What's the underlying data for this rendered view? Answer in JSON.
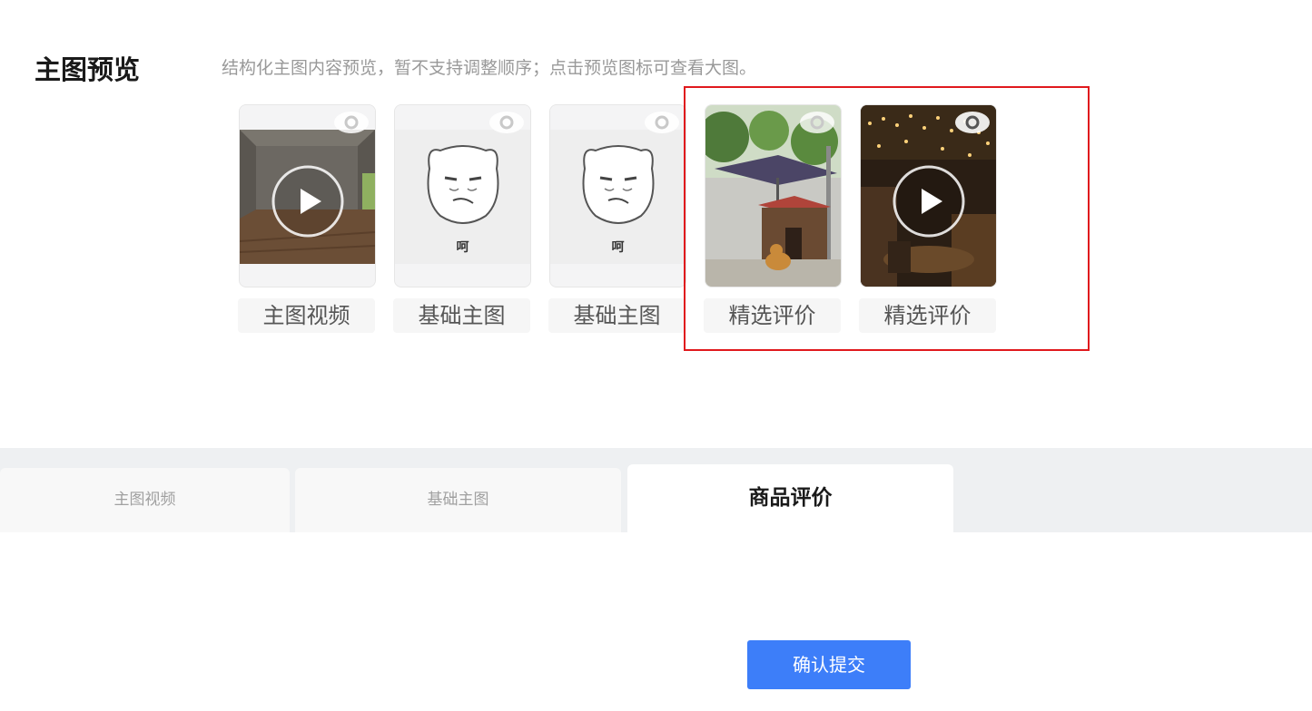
{
  "preview": {
    "title": "主图预览",
    "description": "结构化主图内容预览，暂不支持调整顺序；点击预览图标可查看大图。",
    "items": [
      {
        "label": "主图视频",
        "type": "video"
      },
      {
        "label": "基础主图",
        "type": "image",
        "caption": "呵"
      },
      {
        "label": "基础主图",
        "type": "image",
        "caption": "呵"
      },
      {
        "label": "精选评价",
        "type": "image"
      },
      {
        "label": "精选评价",
        "type": "video"
      }
    ]
  },
  "tabs": [
    {
      "label": "主图视频",
      "active": false
    },
    {
      "label": "基础主图",
      "active": false
    },
    {
      "label": "商品评价",
      "active": true
    }
  ],
  "actions": {
    "confirm_label": "确认提交"
  },
  "colors": {
    "accent": "#3d7ef9",
    "highlight": "#e0191d"
  },
  "icons": {
    "preview": "eye-icon",
    "play": "play-icon"
  }
}
